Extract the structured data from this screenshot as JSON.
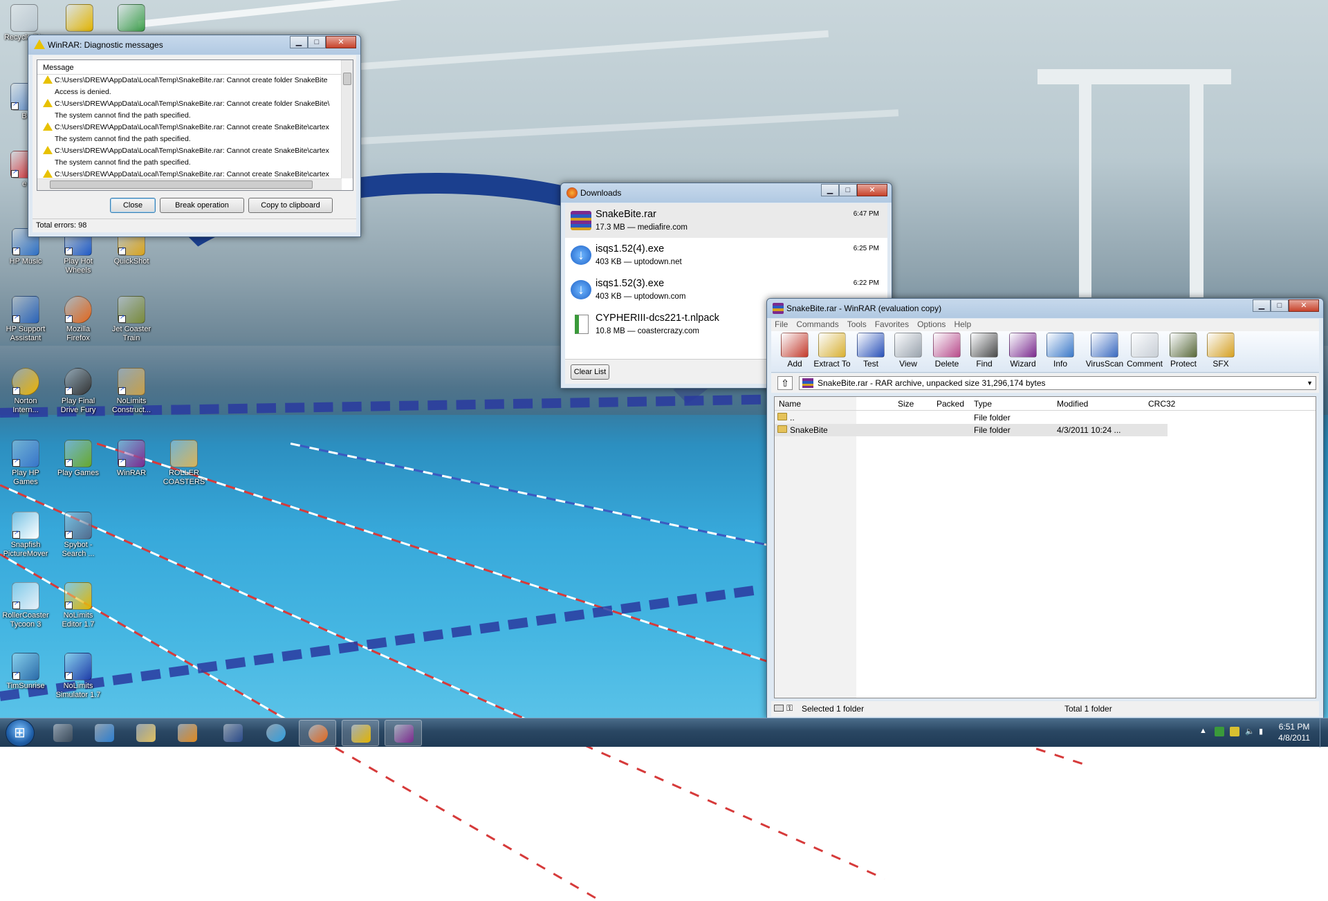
{
  "desktop": {
    "icons": [
      {
        "label": "Recycle Bin",
        "color": "#b9c6cf"
      },
      {
        "label": "",
        "color": "#e3b400"
      },
      {
        "label": "",
        "color": "#3c9e4a"
      },
      {
        "label": "B",
        "color": "#5a89c8"
      },
      {
        "label": "e",
        "color": "#d8262b"
      },
      {
        "label": "HP Music",
        "color": "#2d6fc4"
      },
      {
        "label": "Play Hot Wheels",
        "color": "#1f5ac6"
      },
      {
        "label": "QuickShot",
        "color": "#d9a31c"
      },
      {
        "label": "HP Support Assistant",
        "color": "#2a63b8"
      },
      {
        "label": "Mozilla Firefox",
        "color": "#e4661a"
      },
      {
        "label": "Jet Coaster Train",
        "color": "#7a8b3a"
      },
      {
        "label": "Norton Intern...",
        "color": "#f0b400"
      },
      {
        "label": "Play Final Drive Fury",
        "color": "#333333"
      },
      {
        "label": "NoLimits Construct...",
        "color": "#c9a14a"
      },
      {
        "label": "Play HP Games",
        "color": "#3774c8"
      },
      {
        "label": "Play Games",
        "color": "#68a82c"
      },
      {
        "label": "WinRAR",
        "color": "#7b2a8e"
      },
      {
        "label": "ROLLER COASTERS",
        "color": "#d6b35a"
      },
      {
        "label": "Snapfish PictureMover",
        "color": "#ffffff"
      },
      {
        "label": "Spybot - Search ...",
        "color": "#506a8c"
      },
      {
        "label": "RollerCoaster Tycoon 3",
        "color": "#e8f0f8"
      },
      {
        "label": "NoLimits Editor 1.7",
        "color": "#e3b400"
      },
      {
        "label": "TimSunrise",
        "color": "#2a6aa8"
      },
      {
        "label": "NoLimits Simulator 1.7",
        "color": "#1f3ca8"
      }
    ]
  },
  "diag": {
    "title": "WinRAR: Diagnostic messages",
    "column": "Message",
    "messages": [
      {
        "line": "C:\\Users\\DREW\\AppData\\Local\\Temp\\SnakeBite.rar: Cannot create folder SnakeBite",
        "sub": "Access is denied."
      },
      {
        "line": "C:\\Users\\DREW\\AppData\\Local\\Temp\\SnakeBite.rar: Cannot create folder SnakeBite\\",
        "sub": "The system cannot find the path specified."
      },
      {
        "line": "C:\\Users\\DREW\\AppData\\Local\\Temp\\SnakeBite.rar: Cannot create SnakeBite\\cartex",
        "sub": "The system cannot find the path specified."
      },
      {
        "line": "C:\\Users\\DREW\\AppData\\Local\\Temp\\SnakeBite.rar: Cannot create SnakeBite\\cartex",
        "sub": "The system cannot find the path specified."
      },
      {
        "line": "C:\\Users\\DREW\\AppData\\Local\\Temp\\SnakeBite.rar: Cannot create SnakeBite\\cartex",
        "sub": ""
      }
    ],
    "buttons": {
      "close": "Close",
      "break": "Break operation",
      "copy": "Copy to clipboard"
    },
    "status": "Total errors: 98"
  },
  "downloads": {
    "title": "Downloads",
    "items": [
      {
        "name": "SnakeBite.rar",
        "info": "17.3 MB — mediafire.com",
        "time": "6:47 PM",
        "icon": "winrar-icon"
      },
      {
        "name": "isqs1.52(4).exe",
        "info": "403 KB — uptodown.net",
        "time": "6:25 PM",
        "icon": "download-arrow-icon"
      },
      {
        "name": "isqs1.52(3).exe",
        "info": "403 KB — uptodown.com",
        "time": "6:22 PM",
        "icon": "download-arrow-icon"
      },
      {
        "name": "CYPHERIII-dcs221-t.nlpack",
        "info": "10.8 MB — coastercrazy.com",
        "time": "",
        "icon": "file-icon"
      }
    ],
    "clear_label": "Clear List"
  },
  "rar": {
    "title": "SnakeBite.rar - WinRAR (evaluation copy)",
    "menu": [
      "File",
      "Commands",
      "Tools",
      "Favorites",
      "Options",
      "Help"
    ],
    "toolbar": [
      {
        "label": "Add",
        "color": "#c43a2b"
      },
      {
        "label": "Extract To",
        "color": "#d9b030"
      },
      {
        "label": "Test",
        "color": "#2850b8"
      },
      {
        "label": "View",
        "color": "#9aa3ad"
      },
      {
        "label": "Delete",
        "color": "#b84a8a"
      },
      {
        "label": "Find",
        "color": "#4a4a4a"
      },
      {
        "label": "Wizard",
        "color": "#7b2a8e"
      },
      {
        "label": "Info",
        "color": "#3a78c8"
      },
      {
        "label": "VirusScan",
        "color": "#3a6ac0"
      },
      {
        "label": "Comment",
        "color": "#c9cfd6"
      },
      {
        "label": "Protect",
        "color": "#5a6a3a"
      },
      {
        "label": "SFX",
        "color": "#d6a020"
      }
    ],
    "path": "SnakeBite.rar - RAR archive, unpacked size 31,296,174 bytes",
    "columns": {
      "name": "Name",
      "size": "Size",
      "packed": "Packed",
      "type": "Type",
      "modified": "Modified",
      "crc": "CRC32"
    },
    "rows": [
      {
        "name": "..",
        "type": "File folder",
        "modified": ""
      },
      {
        "name": "SnakeBite",
        "type": "File folder",
        "modified": "4/3/2011 10:24 ..."
      }
    ],
    "status_left": "Selected 1 folder",
    "status_right": "Total 1 folder"
  },
  "taskbar": {
    "time": "6:51 PM",
    "date": "4/8/2011",
    "apps": [
      {
        "name": "hp-icon",
        "color": "#3a4a5a"
      },
      {
        "name": "internet-explorer-icon",
        "color": "#2d7fd0"
      },
      {
        "name": "explorer-folder-icon",
        "color": "#e0c060"
      },
      {
        "name": "media-player-icon",
        "color": "#e08a20"
      },
      {
        "name": "checkmark-app-icon",
        "color": "#2a4a8a"
      },
      {
        "name": "circle-app-icon",
        "color": "#30a0e0"
      },
      {
        "name": "firefox-icon",
        "color": "#e4661a"
      },
      {
        "name": "roller-coaster-icon",
        "color": "#e3b400"
      },
      {
        "name": "winrar-icon",
        "color": "#7b2a8e"
      }
    ]
  }
}
